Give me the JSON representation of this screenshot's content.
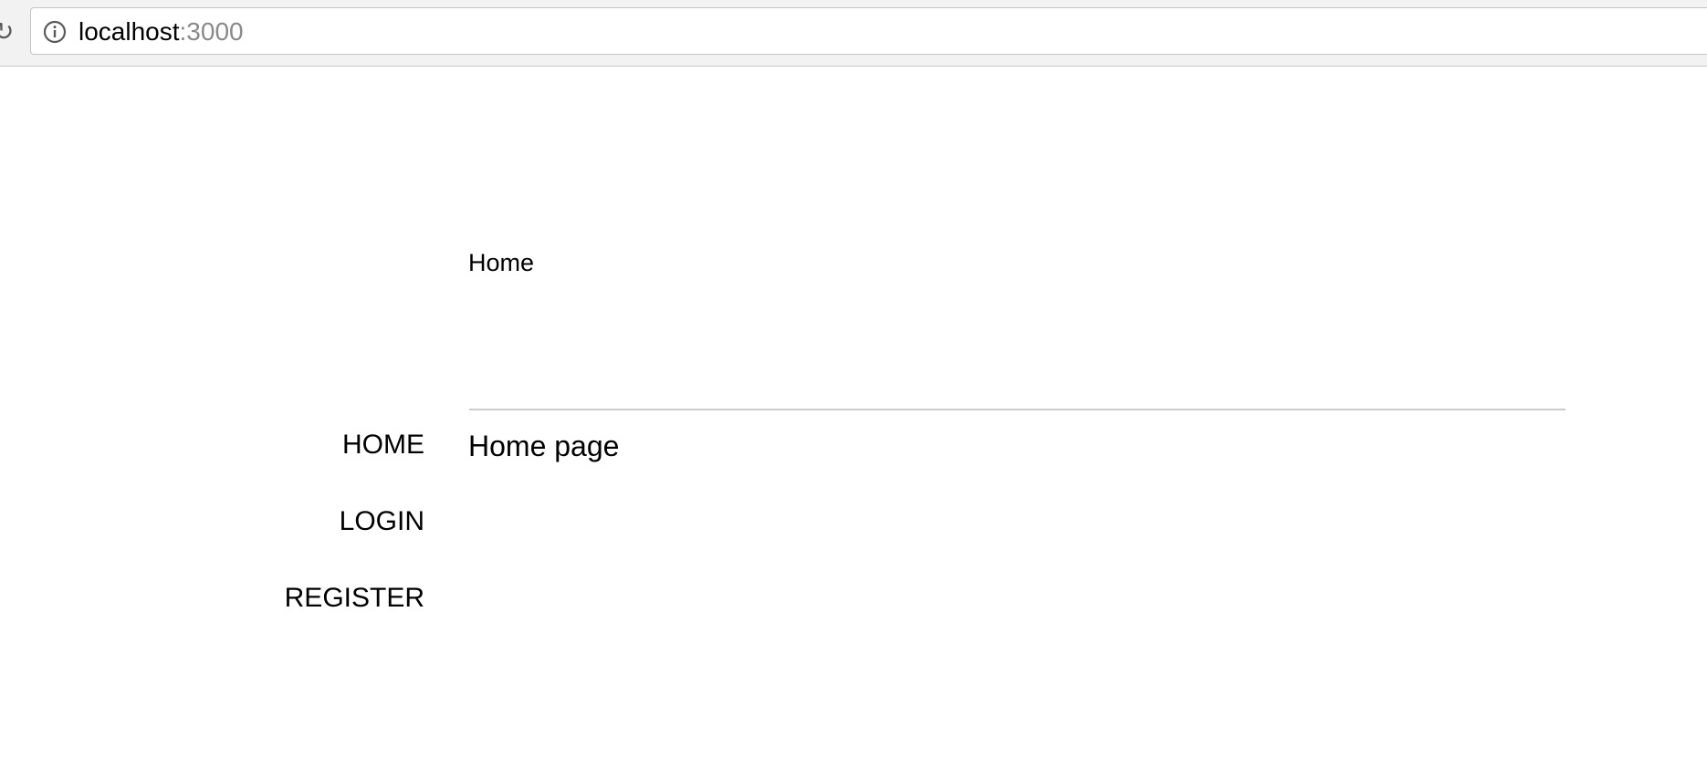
{
  "browser": {
    "url_host": "localhost",
    "url_port": ":3000",
    "reload_icon": "reload-icon",
    "info_icon": "info-icon"
  },
  "page": {
    "title": "Home",
    "heading": "Home page"
  },
  "nav": {
    "items": [
      {
        "label": "HOME"
      },
      {
        "label": "LOGIN"
      },
      {
        "label": "REGISTER"
      }
    ]
  },
  "colors": {
    "text": "#000000",
    "divider": "#cccccc",
    "url_port": "#8a8a8a",
    "toolbar": "#f2f2f2"
  }
}
